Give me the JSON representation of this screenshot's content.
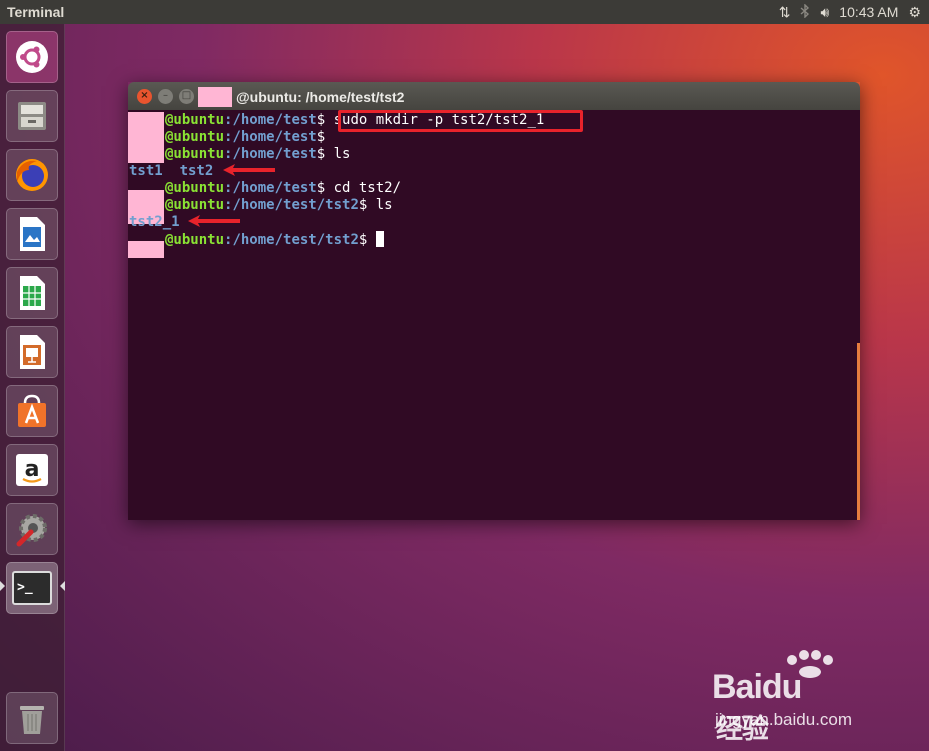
{
  "top_panel": {
    "app_title": "Terminal",
    "clock": "10:43 AM",
    "icons": [
      "network-icon",
      "bluetooth-icon",
      "volume-icon",
      "settings-gear-icon"
    ]
  },
  "launcher": {
    "items": [
      {
        "name": "ubuntu-dash-icon"
      },
      {
        "name": "files-icon"
      },
      {
        "name": "firefox-icon"
      },
      {
        "name": "libreoffice-writer-icon"
      },
      {
        "name": "libreoffice-calc-icon"
      },
      {
        "name": "libreoffice-impress-icon"
      },
      {
        "name": "software-center-icon"
      },
      {
        "name": "amazon-icon"
      },
      {
        "name": "system-settings-icon"
      },
      {
        "name": "terminal-icon",
        "label": ">_"
      },
      {
        "name": "trash-icon"
      }
    ]
  },
  "window": {
    "title": "@ubuntu: /home/test/tst2"
  },
  "terminal": {
    "lines": [
      {
        "user": "@ubuntu",
        "path": ":/home/test",
        "sigil": "$ ",
        "cmd": "sudo mkdir -p tst2/tst2_1"
      },
      {
        "user": "@ubuntu",
        "path": ":/home/test",
        "sigil": "$",
        "cmd": ""
      },
      {
        "user": "@ubuntu",
        "path": ":/home/test",
        "sigil": "$ ",
        "cmd": "ls"
      },
      {
        "output": [
          "tst1",
          "tst2"
        ]
      },
      {
        "user": "@ubuntu",
        "path": ":/home/test",
        "sigil": "$ ",
        "cmd": "cd tst2/"
      },
      {
        "user": "@ubuntu",
        "path": ":/home/test/tst2",
        "sigil": "$ ",
        "cmd": "ls"
      },
      {
        "output": [
          "tst2_1"
        ]
      },
      {
        "user": "@ubuntu",
        "path": ":/home/test/tst2",
        "sigil": "$ ",
        "cmd": ""
      }
    ]
  },
  "watermark": {
    "brand": "Baidu",
    "brand_cn": "经验",
    "url": "jingyan.baidu.com"
  },
  "colors": {
    "prompt_user": "#8ae234",
    "prompt_path": "#729fcf",
    "terminal_bg": "#300a24",
    "highlight_red": "#e8232b"
  }
}
